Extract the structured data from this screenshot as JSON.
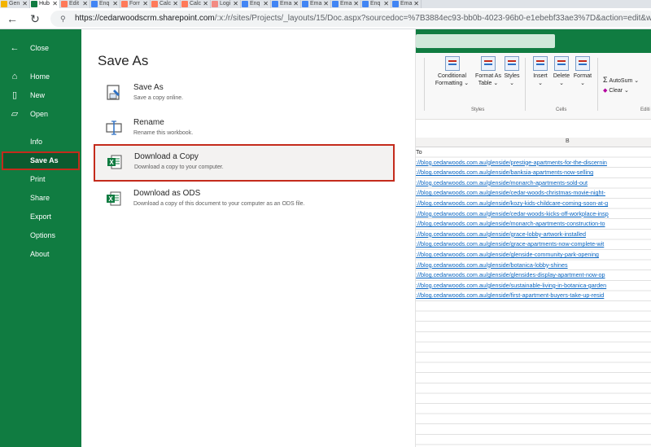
{
  "browser": {
    "tabs": [
      {
        "label": "Gen",
        "color": "#f4b400"
      },
      {
        "label": "Hub",
        "color": "#107c41",
        "active": true
      },
      {
        "label": "Edit",
        "color": "#ff7a59"
      },
      {
        "label": "Enq",
        "color": "#4285f4"
      },
      {
        "label": "Forr",
        "color": "#ff7a59"
      },
      {
        "label": "Calc",
        "color": "#ff7a59"
      },
      {
        "label": "Calc",
        "color": "#ff7a59"
      },
      {
        "label": "Logi",
        "color": "#f28b82"
      },
      {
        "label": "Enq",
        "color": "#4285f4"
      },
      {
        "label": "Ema",
        "color": "#4285f4"
      },
      {
        "label": "Ema",
        "color": "#4285f4"
      },
      {
        "label": "Ema",
        "color": "#4285f4"
      },
      {
        "label": "Enq",
        "color": "#4285f4"
      },
      {
        "label": "Ema",
        "color": "#4285f4"
      }
    ],
    "url_host": "https://cedarwoodscrm.sharepoint.com",
    "url_path": "/:x:/r/sites/Projects/_layouts/15/Doc.aspx?sourcedoc=%7B3884ec93-bb0b-4023-96b0-e1ebebf33ae3%7D&action=edit&wdPreviousSession=",
    "back_icon": "arrow-left-icon",
    "refresh_icon": "refresh-icon",
    "lock_icon": "site-info-icon"
  },
  "backstage": {
    "items": [
      {
        "id": "close",
        "label": "Close",
        "icon": "←"
      },
      {
        "id": "home",
        "label": "Home",
        "icon": "⌂"
      },
      {
        "id": "new",
        "label": "New",
        "icon": "▯"
      },
      {
        "id": "open",
        "label": "Open",
        "icon": "▱"
      },
      {
        "id": "info",
        "label": "Info",
        "icon": ""
      },
      {
        "id": "save-as",
        "label": "Save As",
        "icon": "",
        "selected": true
      },
      {
        "id": "print",
        "label": "Print",
        "icon": ""
      },
      {
        "id": "share",
        "label": "Share",
        "icon": ""
      },
      {
        "id": "export",
        "label": "Export",
        "icon": ""
      },
      {
        "id": "options",
        "label": "Options",
        "icon": ""
      },
      {
        "id": "about",
        "label": "About",
        "icon": ""
      }
    ]
  },
  "save_as": {
    "title": "Save As",
    "options": [
      {
        "id": "save-as",
        "title": "Save As",
        "desc": "Save a copy online."
      },
      {
        "id": "rename",
        "title": "Rename",
        "desc": "Rename this workbook."
      },
      {
        "id": "download-copy",
        "title": "Download a Copy",
        "desc": "Download a copy to your computer.",
        "highlight": true
      },
      {
        "id": "download-ods",
        "title": "Download as ODS",
        "desc": "Download a copy of this document to your computer as an ODS file."
      }
    ]
  },
  "ribbon": {
    "conditional": "Conditional",
    "formatting": "Formatting",
    "format_as": "Format As",
    "table": "Table",
    "styles": "Styles",
    "insert": "Insert",
    "delete": "Delete",
    "format": "Format",
    "autosum": "AutoSum",
    "clear": "Clear",
    "group_styles": "Styles",
    "group_cells": "Cells",
    "group_editing": "Editi"
  },
  "sheet": {
    "column_b": "B",
    "header": "To",
    "links": [
      "://blog.cedarwoods.com.au/glenside/prestige-apartments-for-the-discernin",
      "://blog.cedarwoods.com.au/glenside/banksia-apartments-now-selling",
      "://blog.cedarwoods.com.au/glenside/monarch-apartments-sold-out",
      "://blog.cedarwoods.com.au/glenside/cedar-woods-christmas-movie-night-",
      "://blog.cedarwoods.com.au/glenside/kozy-kids-childcare-coming-soon-at-g",
      "://blog.cedarwoods.com.au/glenside/cedar-woods-kicks-off-workplace-insp",
      "://blog.cedarwoods.com.au/glenside/monarch-apartments-construction-to",
      "://blog.cedarwoods.com.au/glenside/grace-lobby-artwork-installed",
      "://blog.cedarwoods.com.au/glenside/grace-apartments-now-complete-wit",
      "://blog.cedarwoods.com.au/glenside/glenside-community-park-opening",
      "://blog.cedarwoods.com.au/glenside/botanica-lobby-shines",
      "://blog.cedarwoods.com.au/glenside/glensides-display-apartment-now-op",
      "://blog.cedarwoods.com.au/glenside/sustainable-living-in-botanica-garden",
      "://blog.cedarwoods.com.au/glenside/first-apartment-buyers-take-up-resid"
    ]
  }
}
